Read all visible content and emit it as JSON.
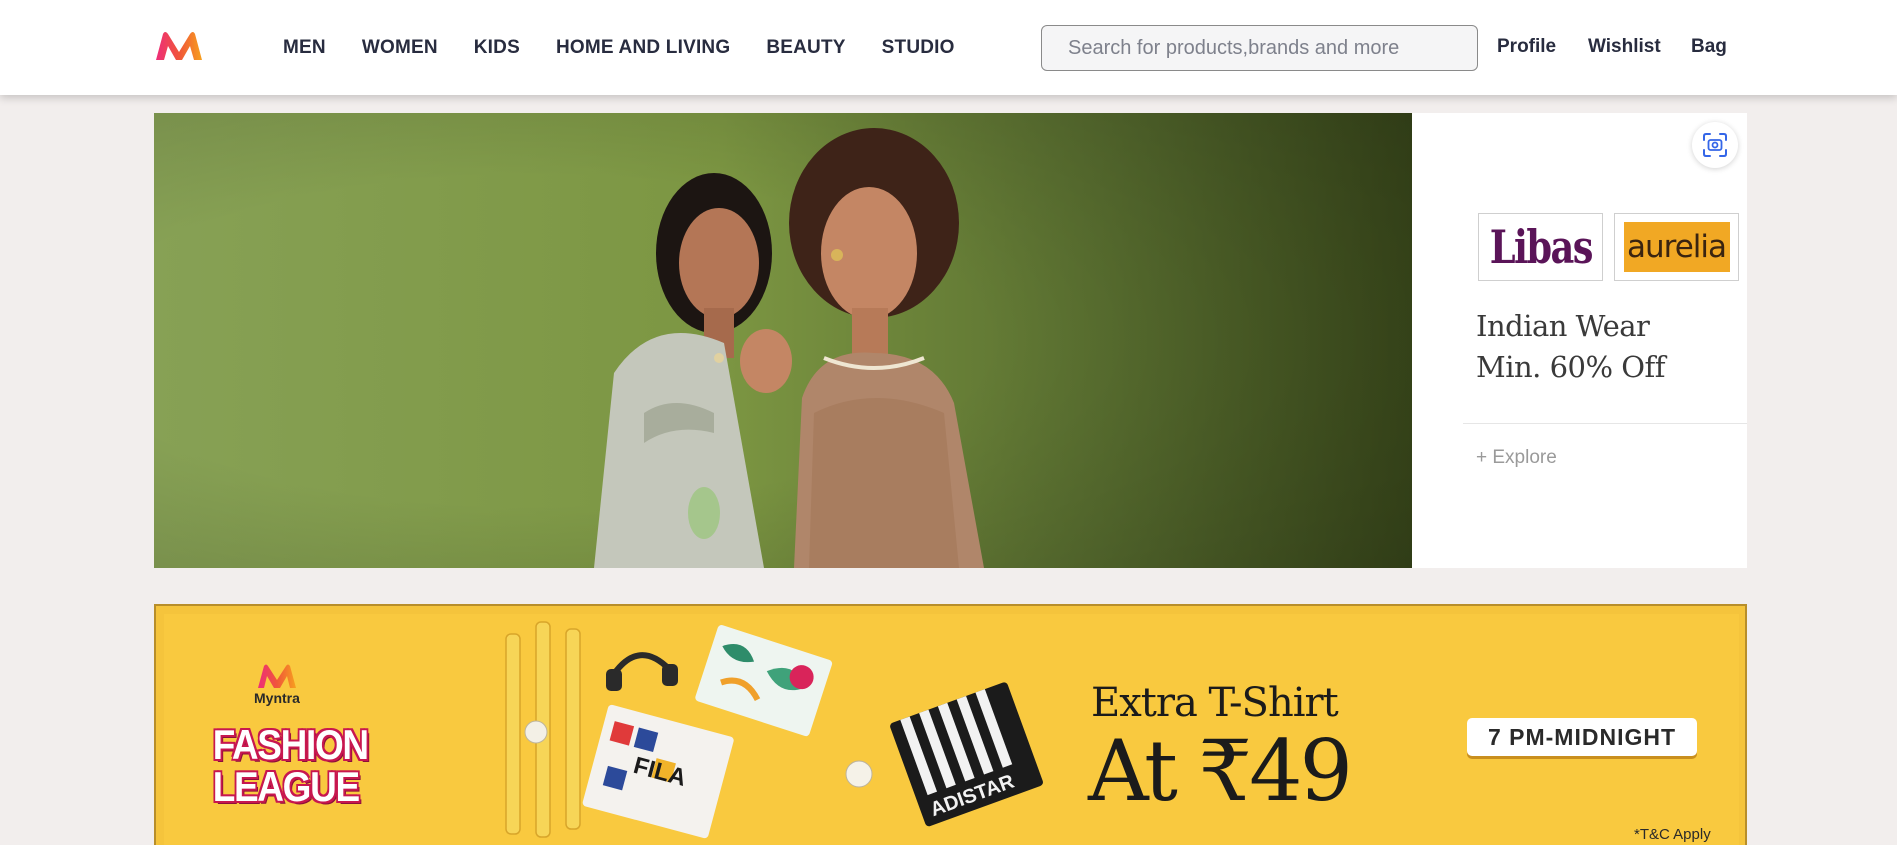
{
  "header": {
    "logo_icon": "myntra-logo",
    "nav": [
      {
        "label": "MEN"
      },
      {
        "label": "WOMEN"
      },
      {
        "label": "KIDS"
      },
      {
        "label": "HOME AND LIVING"
      },
      {
        "label": "BEAUTY"
      },
      {
        "label": "STUDIO"
      }
    ],
    "search_placeholder": "Search for products,brands and more",
    "profile_label": "Profile",
    "wishlist_label": "Wishlist",
    "bag_label": "Bag"
  },
  "hero": {
    "scan_icon": "visual-search-icon",
    "brands": [
      "Libas",
      "aurelia"
    ],
    "heading_line1": "Indian Wear",
    "heading_line2": "Min. 60% Off",
    "cta": "+ Explore"
  },
  "promo": {
    "brand": "Myntra",
    "event_line1": "FASHION",
    "event_line2": "LEAGUE",
    "offer_line1": "Extra T-Shirt",
    "offer_line2": "At ₹49",
    "time_window": "7 PM-MIDNIGHT",
    "terms": "*T&C Apply",
    "shirt_print_1": "FILA",
    "shirt_print_2": "ADISTAR"
  },
  "colors": {
    "brand_pink": "#ff3f6c",
    "brand_orange": "#f7931e",
    "promo_yellow": "#f9c93f",
    "text_dark": "#282c3f"
  }
}
